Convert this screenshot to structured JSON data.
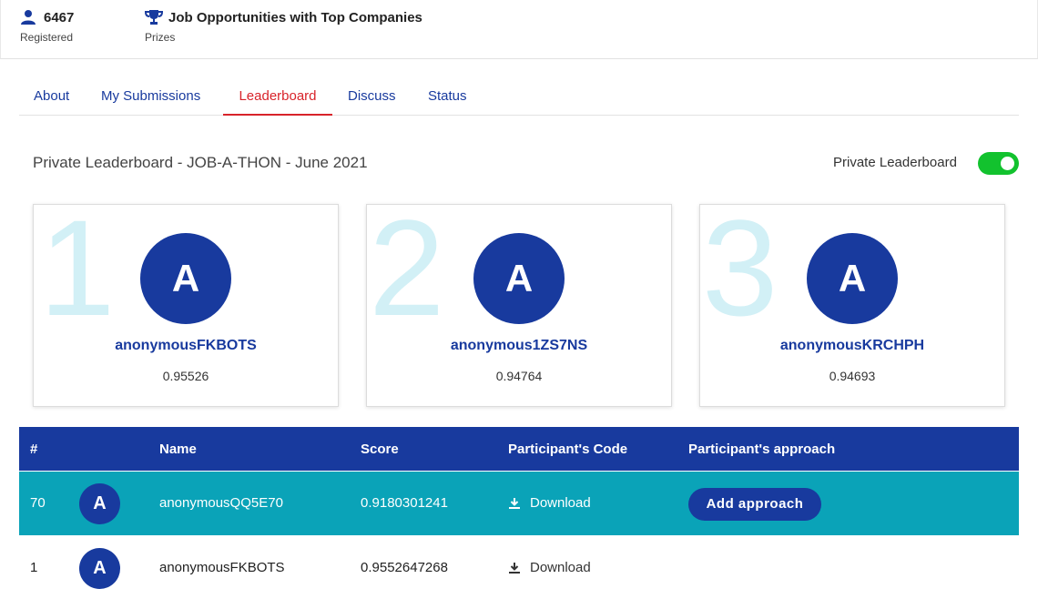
{
  "stats": {
    "registered_value": "6467",
    "registered_label": "Registered",
    "prizes_value": "Job Opportunities with Top Companies",
    "prizes_label": "Prizes"
  },
  "tabs": [
    {
      "label": "About"
    },
    {
      "label": "My Submissions"
    },
    {
      "label": "Leaderboard",
      "active": true
    },
    {
      "label": "Discuss"
    },
    {
      "label": "Status"
    }
  ],
  "leaderboard": {
    "title": "Private Leaderboard - JOB-A-THON - June 2021",
    "toggle_label": "Private Leaderboard",
    "toggle_on": true
  },
  "podium": [
    {
      "rank": "1",
      "initial": "A",
      "name": "anonymousFKBOTS",
      "score": "0.95526"
    },
    {
      "rank": "2",
      "initial": "A",
      "name": "anonymous1ZS7NS",
      "score": "0.94764"
    },
    {
      "rank": "3",
      "initial": "A",
      "name": "anonymousKRCHPH",
      "score": "0.94693"
    }
  ],
  "table": {
    "headers": [
      "#",
      "Name",
      "Score",
      "Participant's Code",
      "Participant's approach"
    ],
    "rows": [
      {
        "rank": "70",
        "initial": "A",
        "name": "anonymousQQ5E70",
        "score": "0.9180301241",
        "code": "Download",
        "approach": "Add approach",
        "highlighted": true
      },
      {
        "rank": "1",
        "initial": "A",
        "name": "anonymousFKBOTS",
        "score": "0.9552647268",
        "code": "Download",
        "approach": ""
      }
    ]
  },
  "colors": {
    "brand_blue": "#183a9e",
    "active_tab_red": "#d8232a",
    "highlight_teal": "#0aa3b8",
    "toggle_green": "#12c22e",
    "rank_numeral": "#d2f0f6"
  },
  "icons": [
    "user-icon",
    "trophy-icon",
    "download-icon"
  ]
}
